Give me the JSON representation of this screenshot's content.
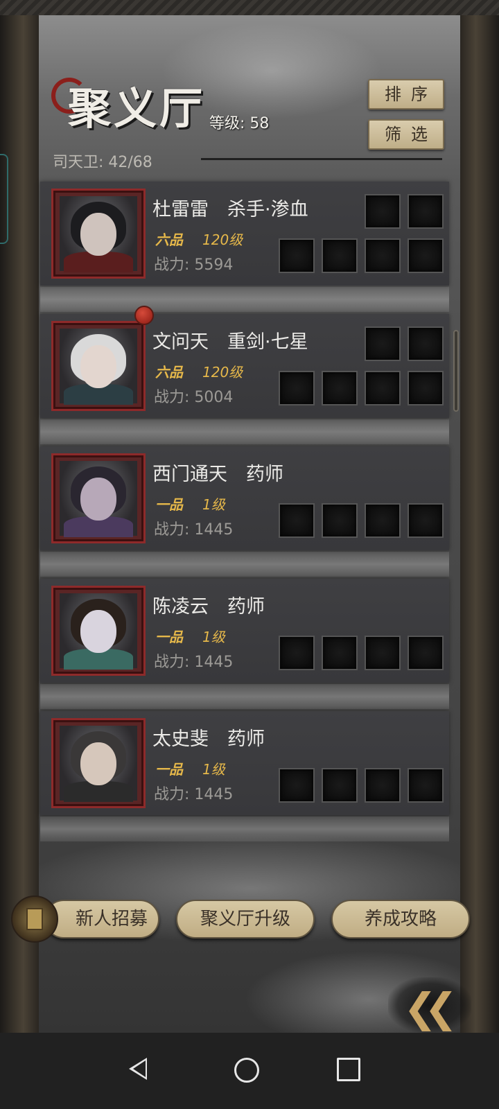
{
  "header": {
    "title": "聚义厅",
    "level_label": "等级: 58",
    "roster_count": "司天卫: 42/68",
    "sort_button": "排序",
    "filter_button": "筛选"
  },
  "heroes": [
    {
      "name": "杜雷雷　杀手·渗血",
      "grade": "六品",
      "level": "120级",
      "power": "战力: 5594",
      "has_notice": false,
      "top_slots": 2,
      "bottom_slots": 4
    },
    {
      "name": "文问天　重剑·七星",
      "grade": "六品",
      "level": "120级",
      "power": "战力: 5004",
      "has_notice": true,
      "top_slots": 2,
      "bottom_slots": 4
    },
    {
      "name": "西门通天　药师",
      "grade": "一品",
      "level": "1级",
      "power": "战力: 1445",
      "has_notice": false,
      "top_slots": 0,
      "bottom_slots": 4
    },
    {
      "name": "陈凌云　药师",
      "grade": "一品",
      "level": "1级",
      "power": "战力: 1445",
      "has_notice": false,
      "top_slots": 0,
      "bottom_slots": 4
    },
    {
      "name": "太史斐　药师",
      "grade": "一品",
      "level": "1级",
      "power": "战力: 1445",
      "has_notice": false,
      "top_slots": 0,
      "bottom_slots": 4
    }
  ],
  "bottom_buttons": {
    "recruit": "新人招募",
    "upgrade": "聚义厅升级",
    "guide": "养成攻略"
  },
  "colors": {
    "grade_gold": "#e6b84a",
    "portrait_frame": "#8e2a2a",
    "button_beige": "#c9b98f"
  },
  "icons": {
    "back": "double-chevron-left-icon",
    "nav_back": "triangle-back-icon",
    "nav_home": "circle-home-icon",
    "nav_recents": "square-recents-icon"
  }
}
